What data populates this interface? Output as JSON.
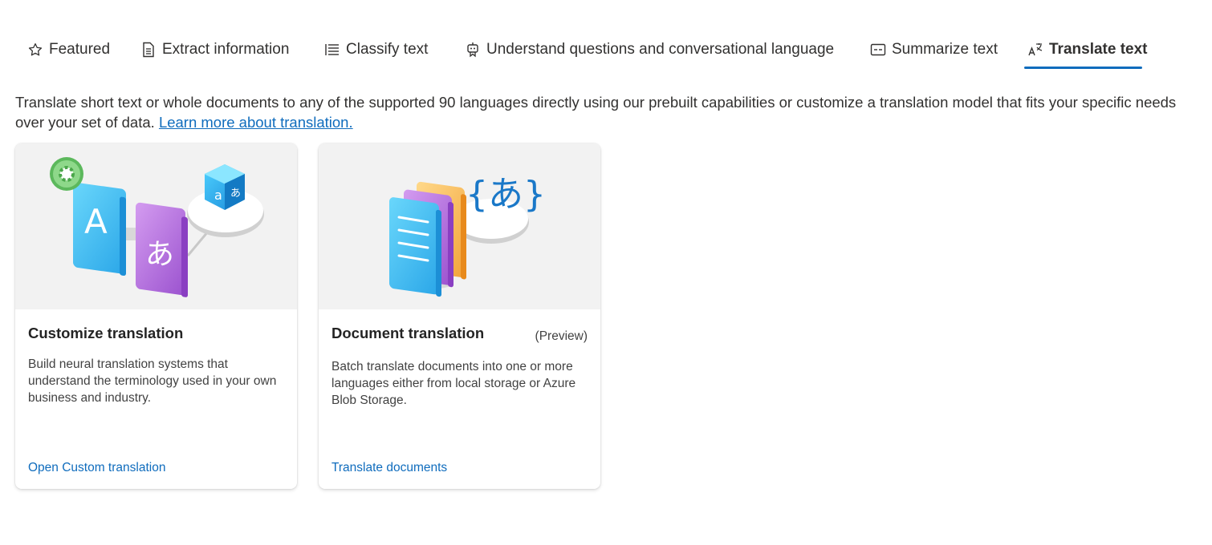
{
  "tabs": [
    {
      "label": "Featured",
      "icon": "star-icon",
      "active": false
    },
    {
      "label": "Extract information",
      "icon": "document-icon",
      "active": false
    },
    {
      "label": "Classify text",
      "icon": "list-icon",
      "active": false
    },
    {
      "label": "Understand questions and conversational language",
      "icon": "bot-icon",
      "active": false
    },
    {
      "label": "Summarize text",
      "icon": "summary-icon",
      "active": false
    },
    {
      "label": "Translate text",
      "icon": "translate-icon",
      "active": true
    }
  ],
  "intro": {
    "text": "Translate short text or whole documents to any of the supported 90 languages directly using our prebuilt capabilities or customize a translation model that fits your specific needs over your set of data. ",
    "link": "Learn more about translation."
  },
  "cards": [
    {
      "title": "Customize translation",
      "tag": "",
      "body": "Build neural translation systems that understand the terminology used in your own business and industry.",
      "link": "Open Custom translation",
      "illustration": "custom-translation-illustration",
      "art_glyphs": {
        "letter": "A",
        "kana": "あ",
        "cube_latin": "a",
        "cube_kana": "あ"
      }
    },
    {
      "title": "Document translation",
      "tag": "(Preview)",
      "body": "Batch translate documents into one or more languages either from local storage or Azure Blob Storage.",
      "link": "Translate documents",
      "illustration": "document-translation-illustration",
      "art_glyphs": {
        "braced_kana": "{あ}"
      }
    }
  ],
  "colors": {
    "accent": "#0f6cbd",
    "text": "#323130",
    "card_art_bg": "#f2f2f2"
  }
}
